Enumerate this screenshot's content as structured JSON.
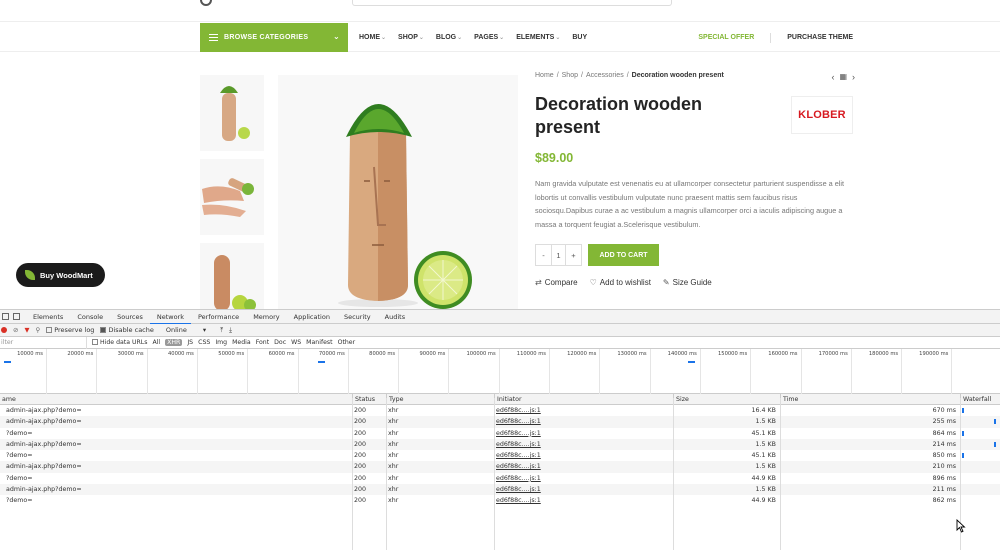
{
  "site": {
    "nav": {
      "browse_label": "BROWSE CATEGORIES",
      "menu": [
        "HOME",
        "SHOP",
        "BLOG",
        "PAGES",
        "ELEMENTS",
        "BUY"
      ],
      "menu_has_dropdown": [
        true,
        true,
        true,
        true,
        true,
        false
      ],
      "special_offer": "SPECIAL OFFER",
      "purchase_theme": "PURCHASE THEME"
    },
    "buy_button": "Buy WoodMart",
    "product": {
      "breadcrumb": [
        "Home",
        "Shop",
        "Accessories",
        "Decoration wooden present"
      ],
      "title": "Decoration wooden present",
      "price": "$89.00",
      "description": "Nam gravida vulputate est venenatis eu at ullamcorper consectetur parturient suspendisse a elit lobortis ut convallis vestibulum vulputate nunc praesent mattis sem faucibus risus sociosqu.Dapibus curae a ac vestibulum a magnis ullamcorper orci a iaculis adipiscing augue a massa a torquent feugiat a.Scelerisque vestibulum.",
      "brand": "KLOBER",
      "qty_minus": "-",
      "qty_value": "1",
      "qty_plus": "+",
      "add_to_cart": "ADD TO CART",
      "compare": "Compare",
      "wishlist": "Add to wishlist",
      "size_guide": "Size Guide"
    },
    "colors": {
      "accent": "#83b735",
      "brand_red": "#d71920"
    }
  },
  "devtools": {
    "tabs": [
      "Elements",
      "Console",
      "Sources",
      "Network",
      "Performance",
      "Memory",
      "Application",
      "Security",
      "Audits"
    ],
    "active_tab": "Network",
    "toolbar": {
      "preserve_log": "Preserve log",
      "disable_cache": "Disable cache",
      "throttle": "Online"
    },
    "filter": {
      "placeholder": "ilter",
      "hide_data_urls": "Hide data URLs",
      "types": [
        "All",
        "XHR",
        "JS",
        "CSS",
        "Img",
        "Media",
        "Font",
        "Doc",
        "WS",
        "Manifest",
        "Other"
      ]
    },
    "ticks": [
      "10000 ms",
      "20000 ms",
      "30000 ms",
      "40000 ms",
      "50000 ms",
      "60000 ms",
      "70000 ms",
      "80000 ms",
      "90000 ms",
      "100000 ms",
      "110000 ms",
      "120000 ms",
      "130000 ms",
      "140000 ms",
      "150000 ms",
      "160000 ms",
      "170000 ms",
      "180000 ms",
      "190000 ms"
    ],
    "columns": [
      "ame",
      "Status",
      "Type",
      "Initiator",
      "Size",
      "Time",
      "Waterfall"
    ],
    "requests": [
      {
        "name": "admin-ajax.php?demo=",
        "status": "200",
        "type": "xhr",
        "initiator": "ed6f88c....js:1",
        "size": "16.4 KB",
        "time": "670 ms"
      },
      {
        "name": "admin-ajax.php?demo=",
        "status": "200",
        "type": "xhr",
        "initiator": "ed6f88c....js:1",
        "size": "1.5 KB",
        "time": "255 ms"
      },
      {
        "name": "?demo=",
        "status": "200",
        "type": "xhr",
        "initiator": "ed6f88c....js:1",
        "size": "45.1 KB",
        "time": "864 ms"
      },
      {
        "name": "admin-ajax.php?demo=",
        "status": "200",
        "type": "xhr",
        "initiator": "ed6f88c....js:1",
        "size": "1.5 KB",
        "time": "214 ms"
      },
      {
        "name": "?demo=",
        "status": "200",
        "type": "xhr",
        "initiator": "ed6f88c....js:1",
        "size": "45.1 KB",
        "time": "850 ms"
      },
      {
        "name": "admin-ajax.php?demo=",
        "status": "200",
        "type": "xhr",
        "initiator": "ed6f88c....js:1",
        "size": "1.5 KB",
        "time": "210 ms"
      },
      {
        "name": "?demo=",
        "status": "200",
        "type": "xhr",
        "initiator": "ed6f88c....js:1",
        "size": "44.9 KB",
        "time": "896 ms"
      },
      {
        "name": "admin-ajax.php?demo=",
        "status": "200",
        "type": "xhr",
        "initiator": "ed6f88c....js:1",
        "size": "1.5 KB",
        "time": "211 ms"
      },
      {
        "name": "?demo=",
        "status": "200",
        "type": "xhr",
        "initiator": "ed6f88c....js:1",
        "size": "44.9 KB",
        "time": "862 ms"
      }
    ]
  }
}
